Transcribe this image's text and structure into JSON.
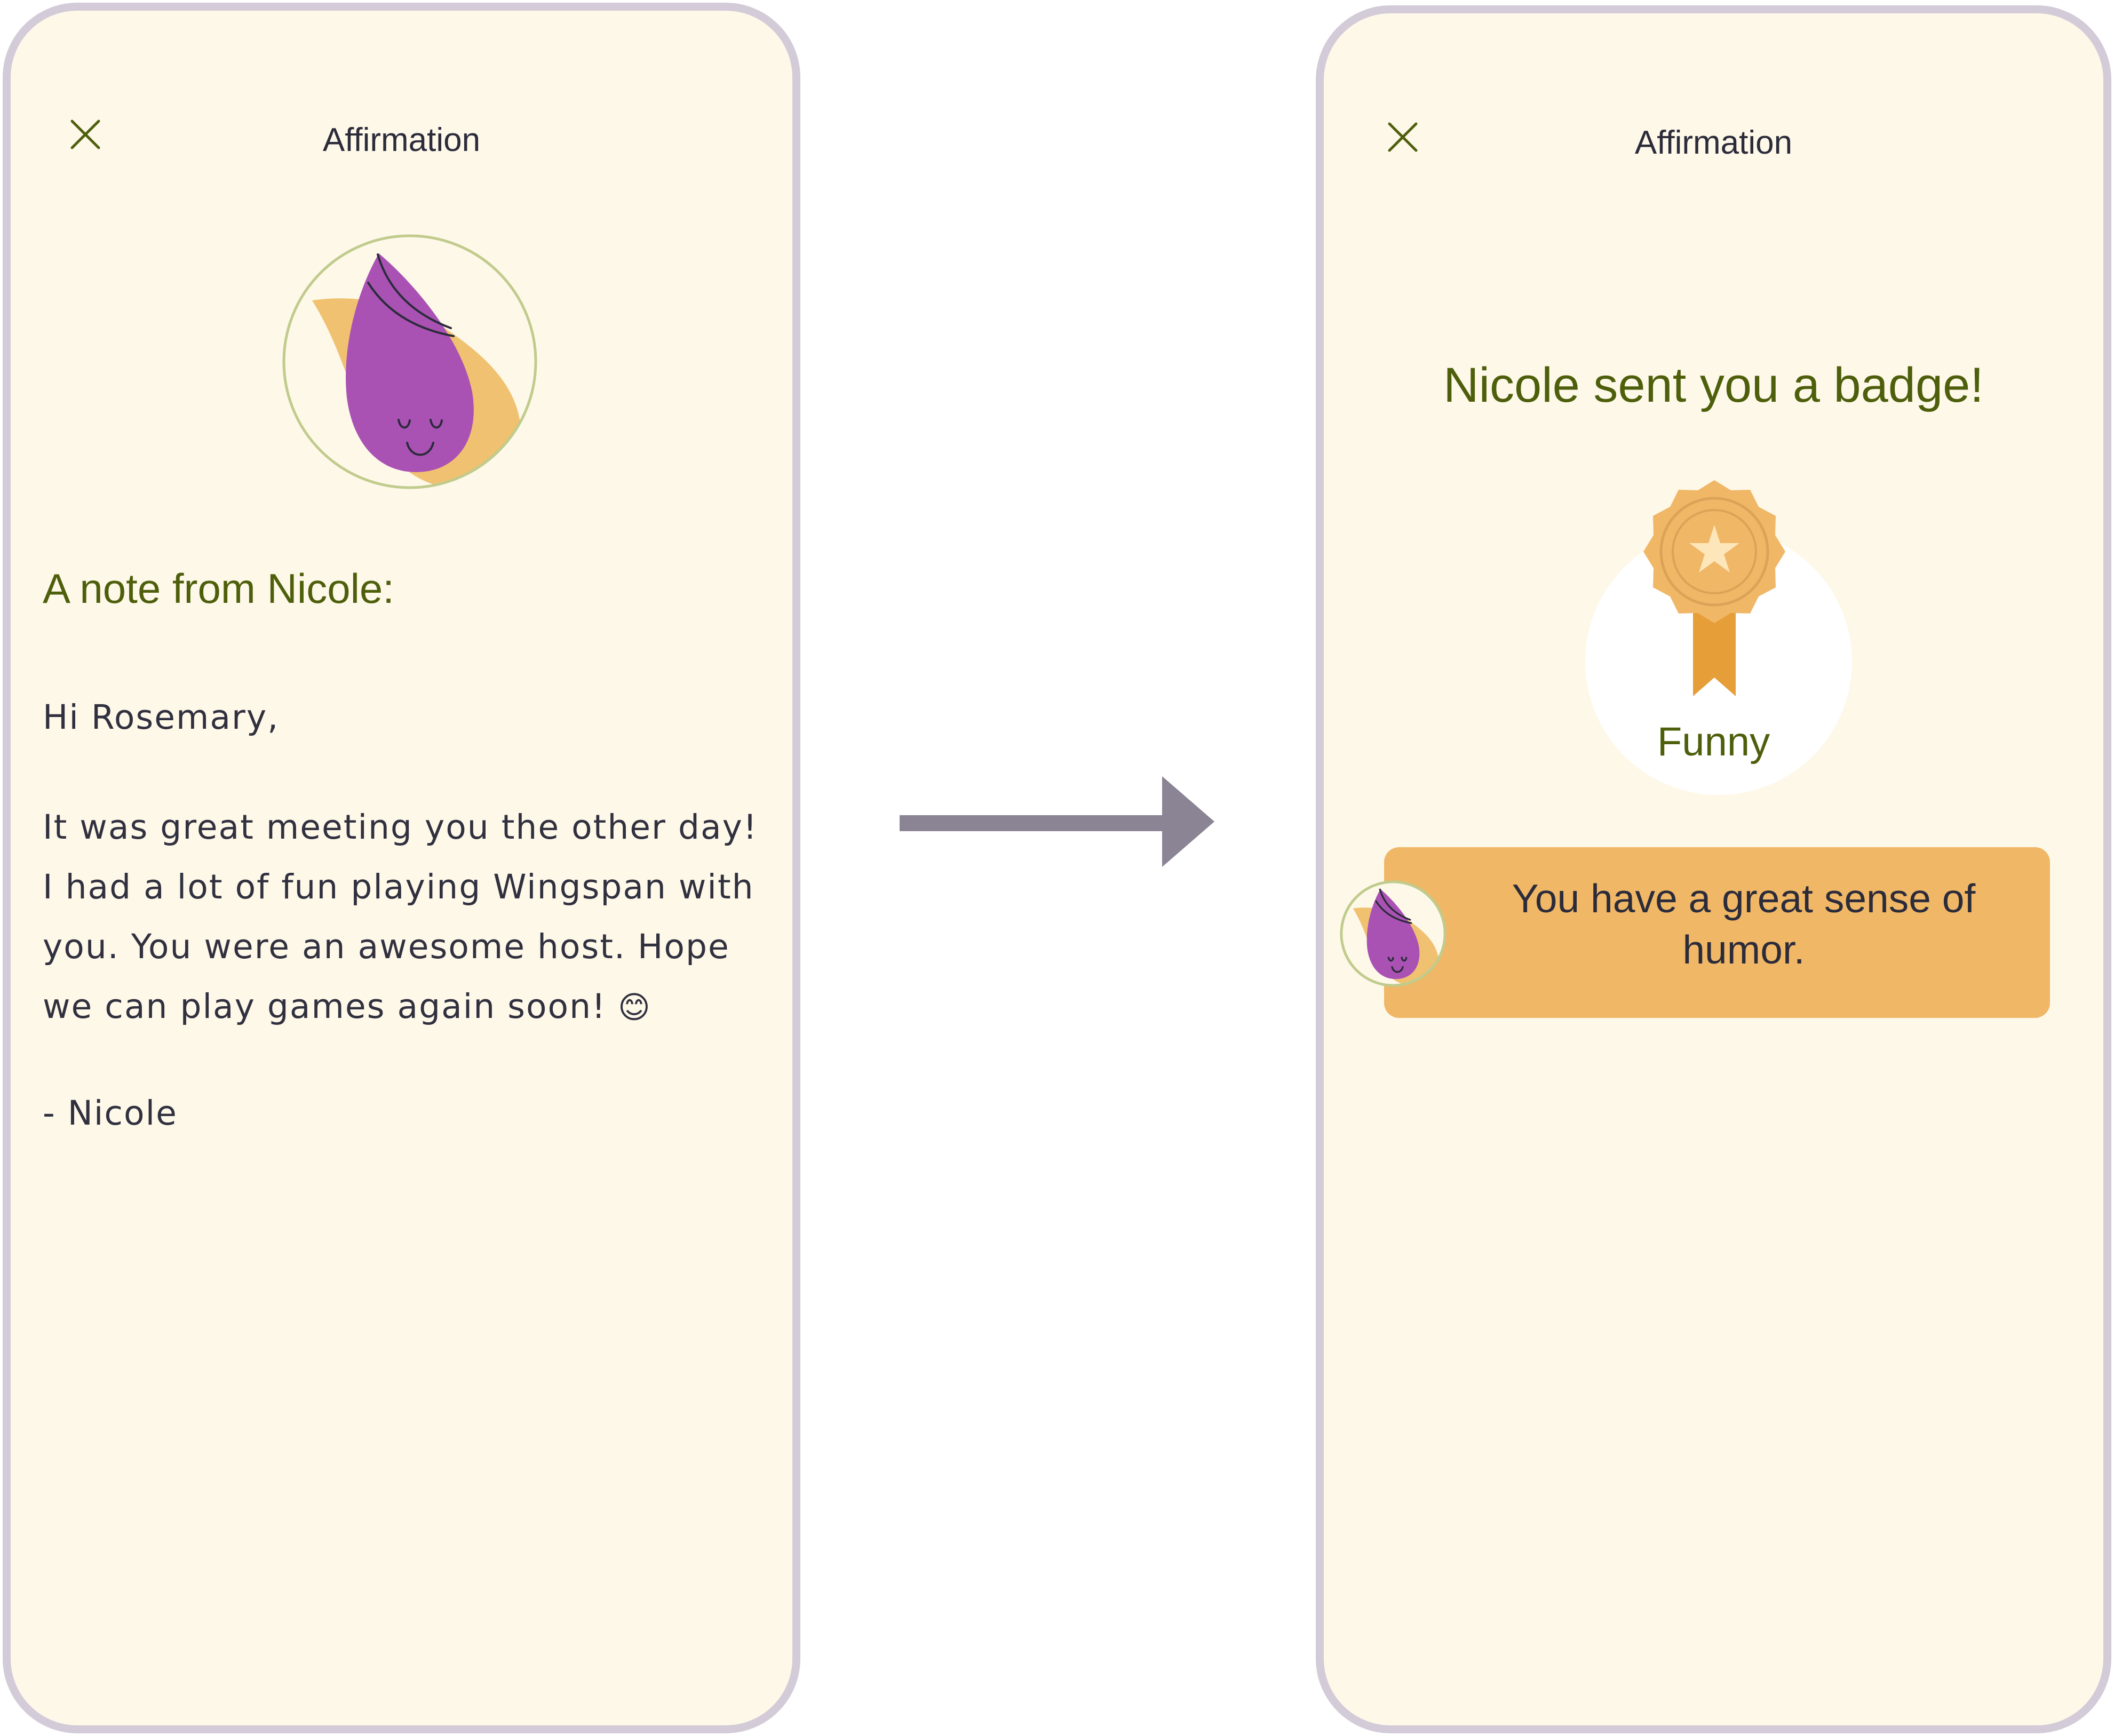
{
  "screens": {
    "note": {
      "title": "Affirmation",
      "heading": "A note from Nicole:",
      "greeting": "Hi Rosemary,",
      "message": "It was great meeting you the other day! I had a lot of fun playing Wingspan with you. You were an awesome host. Hope we can play games again soon!",
      "emoji": "😊",
      "signoff": "- Nicole"
    },
    "badge": {
      "title": "Affirmation",
      "heading": "Nicole sent you a badge!",
      "badge_label": "Funny",
      "message": "You have a great sense of humor."
    }
  },
  "icons": {
    "close": "close-icon",
    "avatar": "sender-avatar-icon",
    "badge": "rosette-badge-icon",
    "transition": "arrow-right-icon"
  },
  "colors": {
    "background": "#fef8e9",
    "frame": "#d3cbd8",
    "heading_green": "#4e5f0c",
    "text": "#30303f",
    "accent_orange": "#f0b767",
    "avatar_purple": "#a952b4",
    "arrow": "#8a8494"
  }
}
